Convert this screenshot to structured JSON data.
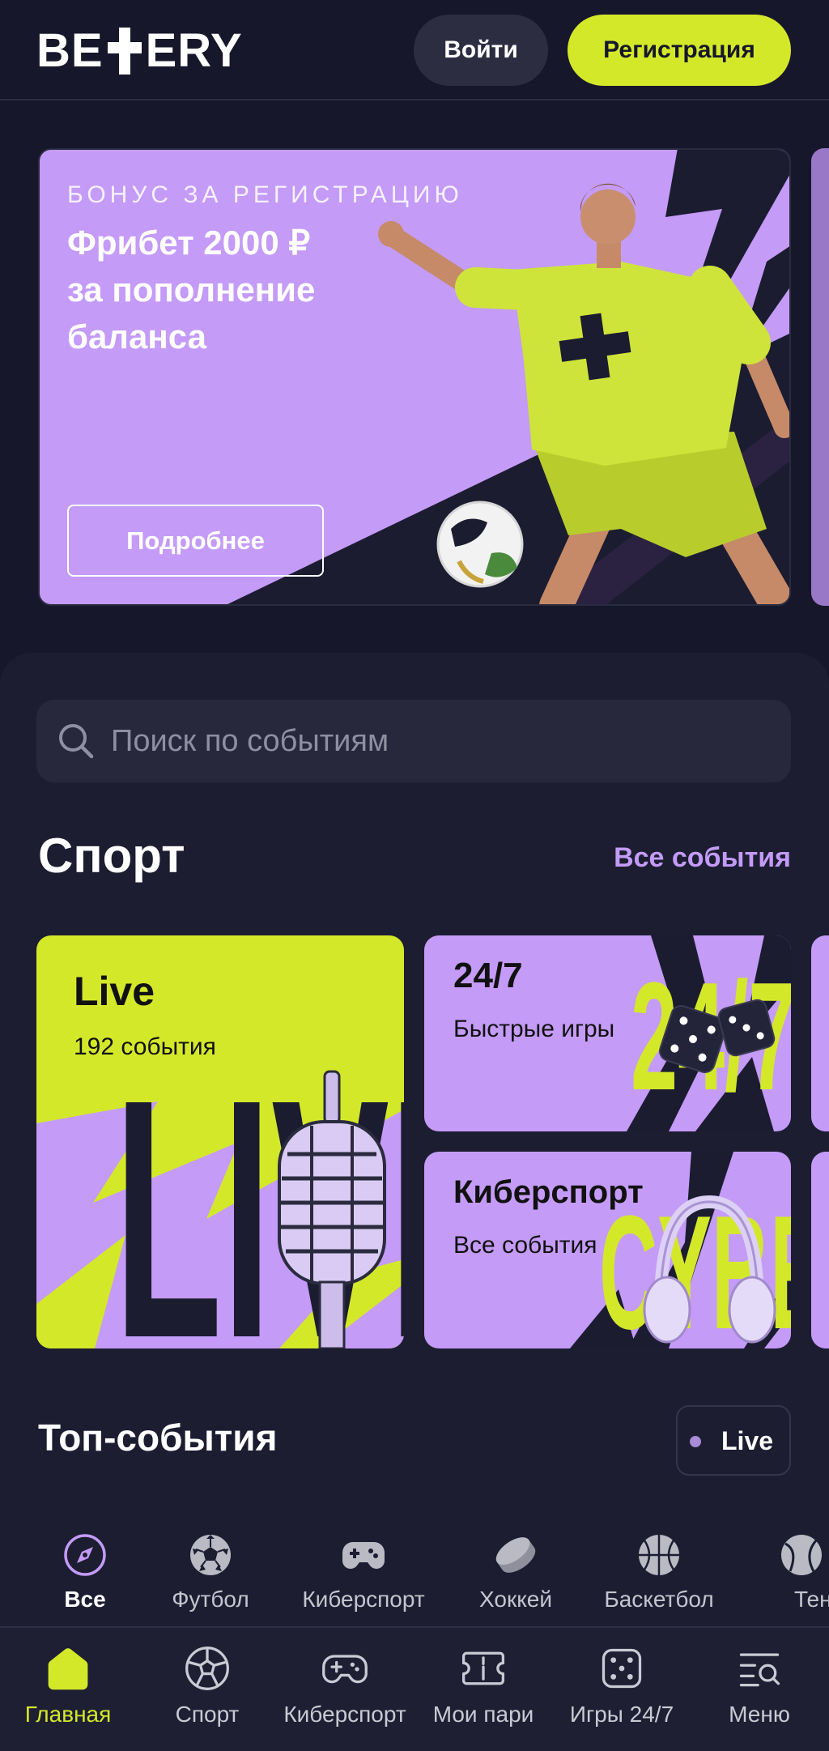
{
  "header": {
    "logo_left": "BE",
    "logo_right": "ERY",
    "login_label": "Войти",
    "register_label": "Регистрация"
  },
  "banner": {
    "eyebrow": "БОНУС ЗА РЕГИСТРАЦИЮ",
    "title_lines": [
      "Фрибет 2000 ₽",
      "за пополнение",
      "баланса"
    ],
    "more_label": "Подробнее"
  },
  "search": {
    "placeholder": "Поиск по событиям",
    "icon": "search-icon"
  },
  "sport": {
    "title": "Спорт",
    "all_events_label": "Все события",
    "tiles": [
      {
        "title": "Live",
        "subtitle": "192 события",
        "art_lettering": "LIVE"
      },
      {
        "title": "24/7",
        "subtitle": "Быстрые игры",
        "art_lettering": "24/7"
      },
      {
        "title": "Киберспорт",
        "subtitle": "Все события",
        "art_lettering": "CYBER"
      }
    ]
  },
  "top_events": {
    "title": "Топ-события",
    "live_filter_label": "Live"
  },
  "categories": [
    {
      "label": "Все",
      "icon": "compass-icon",
      "active": true
    },
    {
      "label": "Футбол",
      "icon": "football-icon",
      "active": false
    },
    {
      "label": "Киберспорт",
      "icon": "gamepad-icon",
      "active": false
    },
    {
      "label": "Хоккей",
      "icon": "hockey-puck-icon",
      "active": false
    },
    {
      "label": "Баскетбол",
      "icon": "basketball-icon",
      "active": false
    },
    {
      "label": "Тенни",
      "icon": "tennis-ball-icon",
      "active": false
    }
  ],
  "bottom_nav": [
    {
      "label": "Главная",
      "icon": "home-icon",
      "active": true
    },
    {
      "label": "Спорт",
      "icon": "football-icon",
      "active": false
    },
    {
      "label": "Киберспорт",
      "icon": "gamepad-icon",
      "active": false
    },
    {
      "label": "Мои пари",
      "icon": "ticket-icon",
      "active": false
    },
    {
      "label": "Игры 24/7",
      "icon": "dice-icon",
      "active": false
    },
    {
      "label": "Меню",
      "icon": "menu-search-icon",
      "active": false
    }
  ],
  "colors": {
    "background": "#16172b",
    "panel": "#1c1d31",
    "accent_lime": "#d4e82a",
    "accent_purple": "#c49bf7",
    "link_purple": "#c39bf7"
  }
}
